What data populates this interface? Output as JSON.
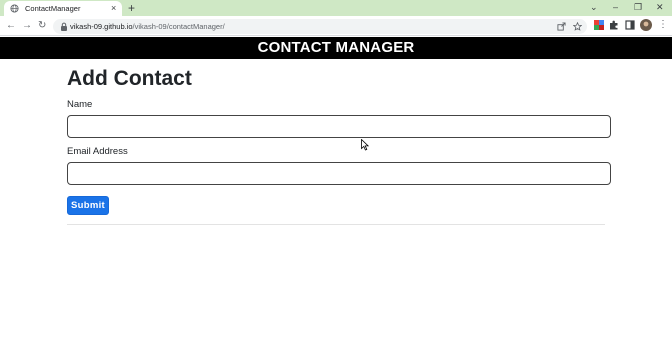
{
  "browser": {
    "tab_title": "ContactManager",
    "tab_close": "×",
    "new_tab": "+",
    "url_host": "vikash-09.github.io",
    "url_path": "/vikash-09/contactManager/",
    "window_controls": [
      "⌄",
      "–",
      "❐",
      "✕"
    ],
    "nav": {
      "back": "←",
      "forward": "→",
      "reload": "↻"
    }
  },
  "app": {
    "title": "CONTACT MANAGER"
  },
  "form": {
    "heading": "Add Contact",
    "name_label": "Name",
    "name_value": "",
    "email_label": "Email Address",
    "email_value": "",
    "submit_label": "Submit"
  },
  "colors": {
    "tabstrip": "#cfe8c5",
    "header_bg": "#000000",
    "submit_bg": "#1a73e8"
  }
}
